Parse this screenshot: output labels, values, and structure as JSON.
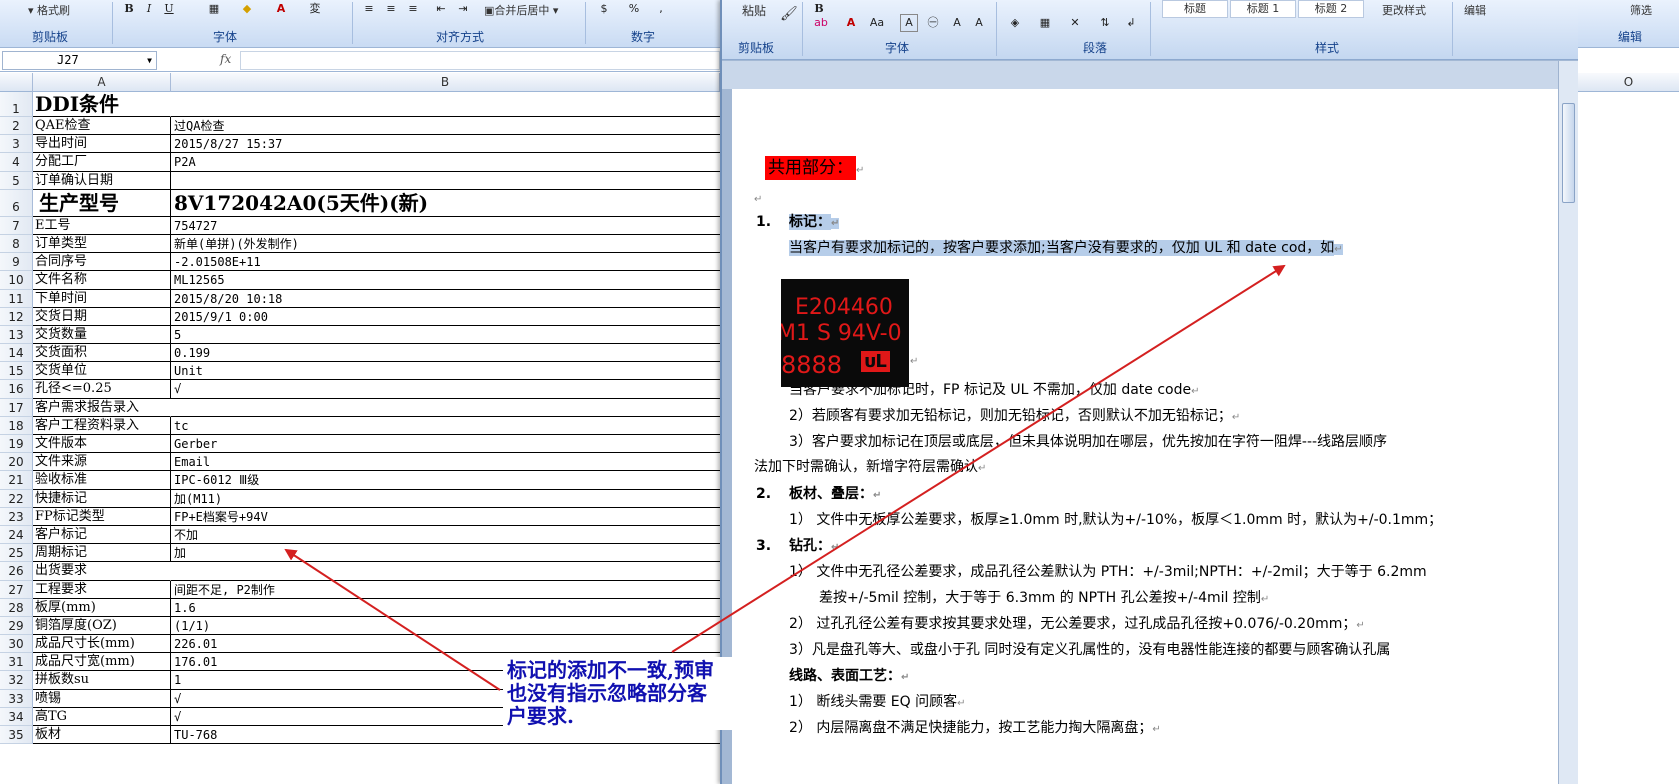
{
  "excel": {
    "ribbon": {
      "clipboard_label": "剪贴板",
      "font_label": "字体",
      "align_label": "对齐方式",
      "number_label": "数字",
      "format_painter": "格式刷",
      "merge_center": "合并后居中",
      "font_color_letter": "A"
    },
    "namebox": "J27",
    "fx": "fx",
    "columns": [
      "A",
      "B"
    ],
    "rows": [
      {
        "n": "1",
        "a": "DDI条件",
        "b": ""
      },
      {
        "n": "2",
        "a": "QAE检查",
        "b": "过QA检查"
      },
      {
        "n": "3",
        "a": "导出时间",
        "b": "2015/8/27 15:37"
      },
      {
        "n": "4",
        "a": "分配工厂",
        "b": "P2A"
      },
      {
        "n": "5",
        "a": "订单确认日期",
        "b": ""
      },
      {
        "n": "6",
        "a": "生产型号",
        "b": "8V172042A0(5天件)(新)"
      },
      {
        "n": "7",
        "a": "E工号",
        "b": "754727"
      },
      {
        "n": "8",
        "a": "订单类型",
        "b": "新单(单拼)(外发制作)"
      },
      {
        "n": "9",
        "a": "合同序号",
        "b": "-2.01508E+11"
      },
      {
        "n": "10",
        "a": "文件名称",
        "b": "ML12565"
      },
      {
        "n": "11",
        "a": "下单时间",
        "b": "2015/8/20 10:18"
      },
      {
        "n": "12",
        "a": "交货日期",
        "b": "2015/9/1 0:00"
      },
      {
        "n": "13",
        "a": "交货数量",
        "b": "5"
      },
      {
        "n": "14",
        "a": "交货面积",
        "b": "0.199"
      },
      {
        "n": "15",
        "a": "交货单位",
        "b": "Unit"
      },
      {
        "n": "16",
        "a": "孔径<=0.25",
        "b": "√"
      },
      {
        "n": "17",
        "a": "客户需求报告录入",
        "b": ""
      },
      {
        "n": "18",
        "a": "客户工程资料录入",
        "b": "tc"
      },
      {
        "n": "19",
        "a": "文件版本",
        "b": "Gerber"
      },
      {
        "n": "20",
        "a": "文件来源",
        "b": "Email"
      },
      {
        "n": "21",
        "a": "验收标准",
        "b": "IPC-6012 Ⅲ级"
      },
      {
        "n": "22",
        "a": "快捷标记",
        "b": "加(M11)"
      },
      {
        "n": "23",
        "a": "FP标记类型",
        "b": "FP+E档案号+94V"
      },
      {
        "n": "24",
        "a": "客户标记",
        "b": "不加"
      },
      {
        "n": "25",
        "a": "周期标记",
        "b": "加"
      },
      {
        "n": "26",
        "a": "出货要求",
        "b": ""
      },
      {
        "n": "27",
        "a": "工程要求",
        "b": "间距不足, P2制作"
      },
      {
        "n": "28",
        "a": "板厚(mm)",
        "b": "1.6"
      },
      {
        "n": "29",
        "a": "铜箔厚度(OZ)",
        "b": "(1/1)"
      },
      {
        "n": "30",
        "a": "成品尺寸长(mm)",
        "b": "226.01"
      },
      {
        "n": "31",
        "a": "成品尺寸宽(mm)",
        "b": "176.01"
      },
      {
        "n": "32",
        "a": "拼板数su",
        "b": "1"
      },
      {
        "n": "33",
        "a": "喷锡",
        "b": "√"
      },
      {
        "n": "34",
        "a": "高TG",
        "b": "√"
      },
      {
        "n": "35",
        "a": "板材",
        "b": "TU-768"
      }
    ],
    "right_col": "O",
    "right_labels": {
      "filter": "筛选",
      "edit": "编辑"
    }
  },
  "word": {
    "ribbon": {
      "paste": "粘贴",
      "clipboard_label": "剪贴板",
      "font_label": "字体",
      "para_label": "段落",
      "styles_label": "样式",
      "edit": "编辑",
      "change_styles": "更改样式",
      "styles": [
        "标题",
        "标题 1",
        "标题 2"
      ]
    },
    "doc": {
      "section": "共用部分：",
      "h1": "1.",
      "h1_text": "标记：",
      "p1": "当客户有要求加标记的，按客户要求添加;当客户没有要求的，仅加 UL 和 date cod，如",
      "logo_line1": "E204460",
      "logo_line2": "M1 S 94V-0",
      "logo_line3": "8888",
      "p2": "当客户要求不加标记时，FP 标记及 UL 不需加，仅加 date code",
      "p3": "2）若顾客有要求加无铅标记，则加无铅标记，否则默认不加无铅标记；",
      "p4": "3）客户要求加标记在顶层或底层，但未具体说明加在哪层，优先按加在字符一阻焊---线路层顺序",
      "p5": "法加下时需确认，新增字符层需确认",
      "h2": "2.",
      "h2_text": "板材、叠层：",
      "p6": "1）  文件中无板厚公差要求，板厚≥1.0mm 时,默认为+/-10%，板厚＜1.0mm 时，默认为+/-0.1mm；",
      "h3": "3.",
      "h3_text": "钻孔：",
      "p7": "1）  文件中无孔径公差要求，成品孔径公差默认为 PTH：+/-3mil;NPTH：+/-2mil；大于等于 6.2mm",
      "p8": "差按+/-5mil 控制，大于等于 6.3mm 的 NPTH 孔公差按+/-4mil 控制",
      "p9": "2）  过孔孔径公差有要求按其要求处理，无公差要求，过孔成品孔径按+0.076/-0.20mm；",
      "p10": "3）凡是盘孔等大、或盘小于孔  同时没有定义孔属性的，没有电器性能连接的都要与顾客确认孔属",
      "h4_text": "线路、表面工艺：",
      "p11": "1）   断线头需要 EQ 问顾客",
      "p12": "2）  内层隔离盘不满足快捷能力，按工艺能力掏大隔离盘；"
    }
  },
  "annotation": {
    "text": "标记的添加不一致,预审也没有指示忽略部分客户要求.",
    "line1": "标记的添加不一致,预审",
    "line2": "也没有指示忽略部分客",
    "line3": "户要求.",
    "arrow_color": "#d42020"
  }
}
